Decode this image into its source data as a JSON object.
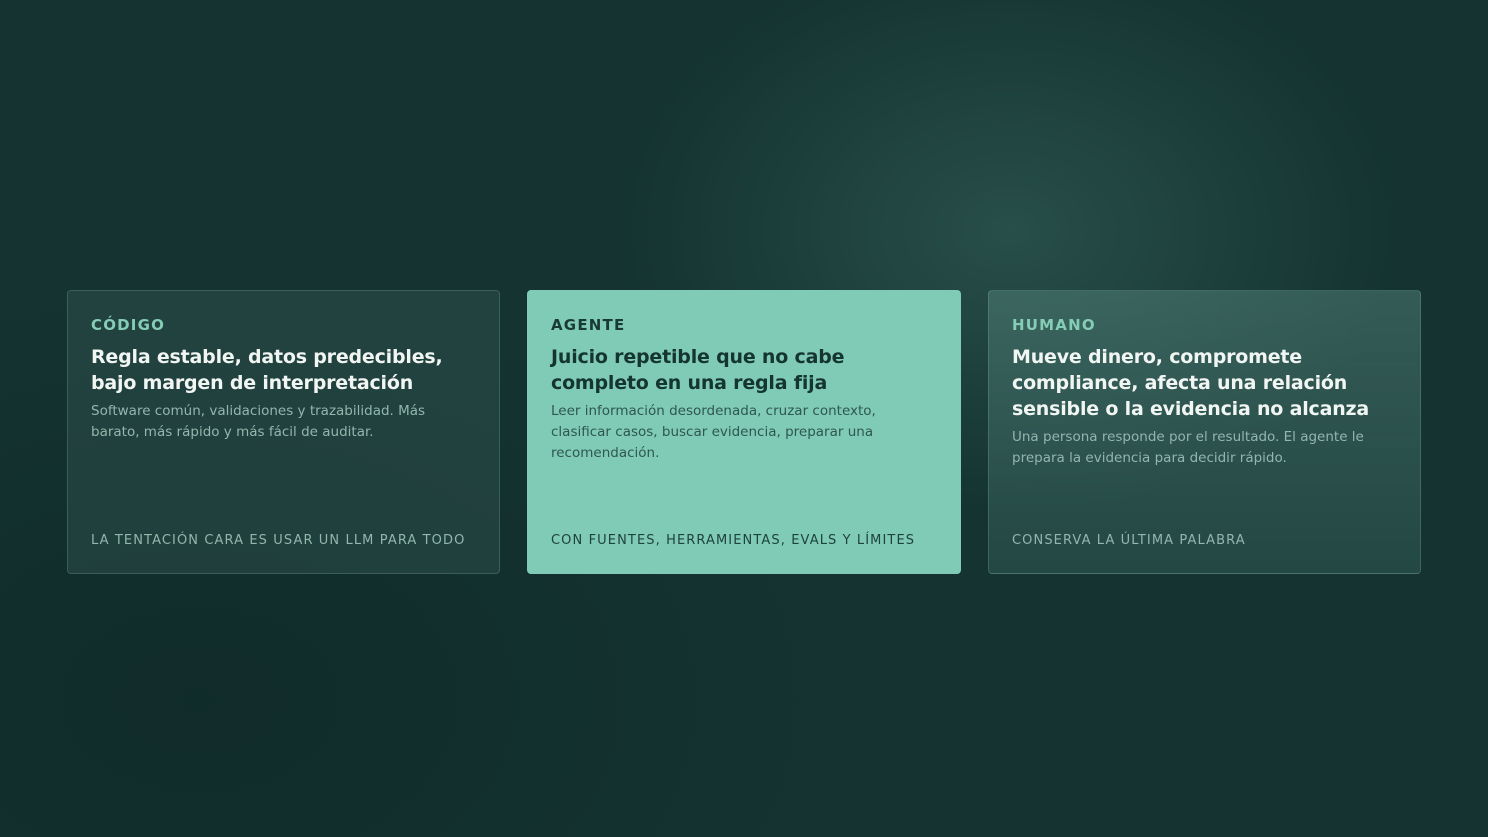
{
  "cards": [
    {
      "eyebrow": "CÓDIGO",
      "title": "Regla estable, datos predecibles, bajo margen de interpretación",
      "description": "Software común, validaciones y trazabilidad. Más barato, más rápido y más fácil de auditar.",
      "footer": "LA TENTACIÓN CARA ES USAR UN LLM PARA TODO"
    },
    {
      "eyebrow": "AGENTE",
      "title": "Juicio repetible que no cabe completo en una regla fija",
      "description": "Leer información desordenada, cruzar contexto, clasificar casos, buscar evidencia, preparar una recomendación.",
      "footer": "CON FUENTES, HERRAMIENTAS, EVALS Y LÍMITES"
    },
    {
      "eyebrow": "HUMANO",
      "title": "Mueve dinero, compromete compliance, afecta una relación sensible o la evidencia no alcanza",
      "description": "Una persona responde por el resultado. El agente le prepara la evidencia para decidir rápido.",
      "footer": "CONSERVA LA ÚLTIMA PALABRA"
    }
  ],
  "colors": {
    "background": "#143331",
    "highlight_card": "#80cbb5",
    "accent_text": "#86cdb6"
  }
}
